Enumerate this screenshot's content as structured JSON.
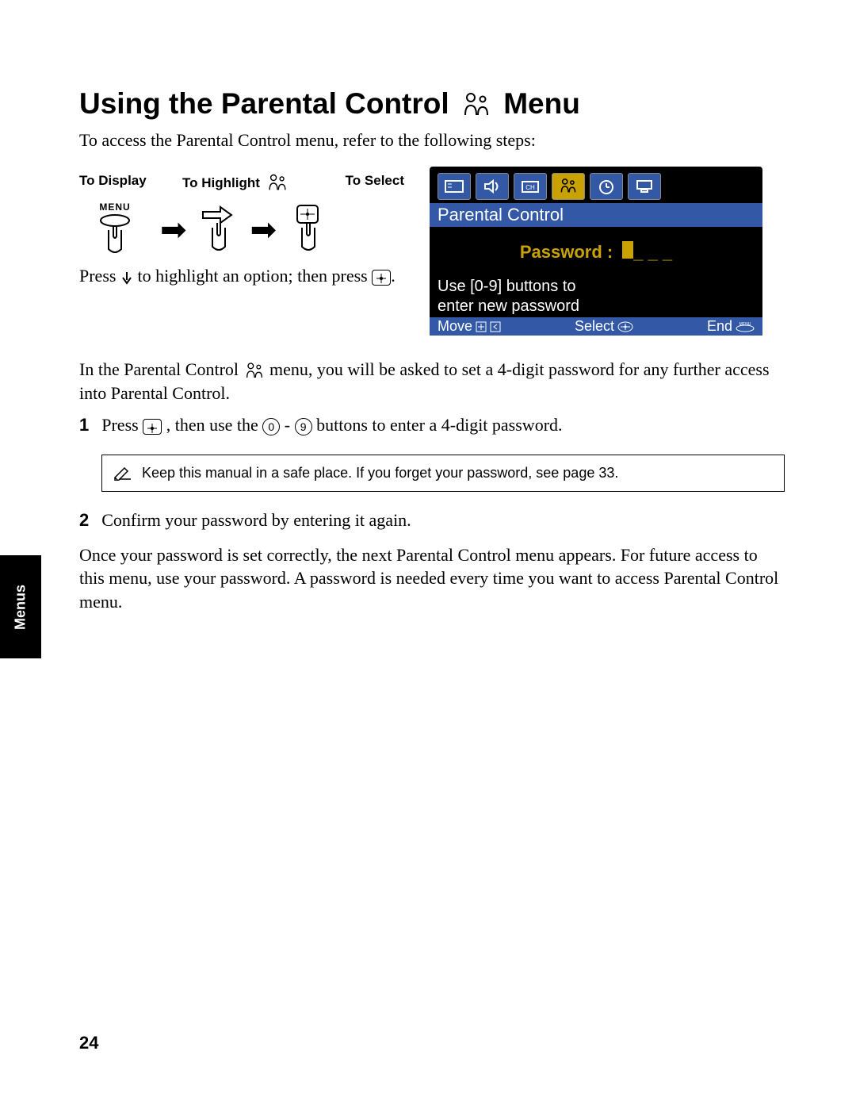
{
  "title_part1": "Using the Parental Control",
  "title_part2": "Menu",
  "intro": "To access the Parental Control menu, refer to the following steps:",
  "headers": {
    "display": "To Display",
    "highlight": "To Highlight",
    "select": "To Select"
  },
  "menu_label": "MENU",
  "press_line_a": "Press ",
  "press_line_b": " to highlight an option; then press ",
  "press_line_c": ".",
  "tv": {
    "title": "Parental Control",
    "pwd_label": "Password :",
    "underscores": "_ _ _",
    "msg1": "Use [0-9] buttons to",
    "msg2": "enter new password",
    "foot_move": "Move",
    "foot_select": "Select",
    "foot_end": "End",
    "foot_end_menu": "MENU"
  },
  "para_a": "In the Parental Control ",
  "para_b": " menu, you will be asked to set a 4-digit password for any further access into Parental Control.",
  "step1_num": "1",
  "step1_a": "Press ",
  "step1_b": ", then use the ",
  "step1_c": "-",
  "step1_d": " buttons to enter a 4-digit password.",
  "note": "Keep this manual in a safe place. If you forget your password, see page 33.",
  "step2_num": "2",
  "step2_text": "Confirm your password by entering it again.",
  "para2": "Once your password is set correctly, the next Parental Control menu appears. For future access to this menu, use your password. A password is needed every time you want to access Parental Control menu.",
  "sidetab": "Menus",
  "page_number": "24",
  "keys": {
    "zero": "0",
    "nine": "9",
    "plus": "+"
  }
}
